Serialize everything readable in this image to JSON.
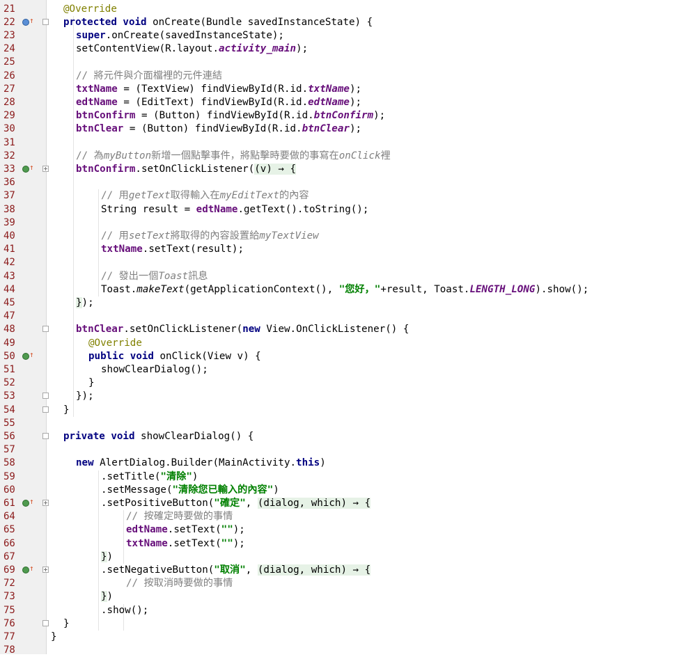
{
  "editor": {
    "lines": [
      {
        "n": "21",
        "seg": [
          [
            "i",
            2
          ],
          [
            "an",
            "@Override"
          ]
        ]
      },
      {
        "n": "22",
        "g": "ov",
        "f": "m",
        "seg": [
          [
            "i",
            2
          ],
          [
            "kw",
            "protected void "
          ],
          [
            "",
            "onCreate(Bundle savedInstanceState) {"
          ]
        ]
      },
      {
        "n": "23",
        "seg": [
          [
            "i",
            4
          ],
          [
            "kw",
            "super"
          ],
          [
            "",
            ".onCreate(savedInstanceState);"
          ]
        ]
      },
      {
        "n": "24",
        "seg": [
          [
            "i",
            4
          ],
          [
            "",
            "setContentView(R.layout."
          ],
          [
            "fi",
            "activity_main"
          ],
          [
            "",
            ");"
          ]
        ]
      },
      {
        "n": "25",
        "seg": []
      },
      {
        "n": "26",
        "seg": [
          [
            "i",
            4
          ],
          [
            "cm",
            "// 將元件與介面檔裡的元件連結"
          ]
        ]
      },
      {
        "n": "27",
        "seg": [
          [
            "i",
            4
          ],
          [
            "fd",
            "txtName"
          ],
          [
            "",
            " = (TextView) findViewById(R.id."
          ],
          [
            "fi",
            "txtName"
          ],
          [
            "",
            ");"
          ]
        ]
      },
      {
        "n": "28",
        "seg": [
          [
            "i",
            4
          ],
          [
            "fd",
            "edtName"
          ],
          [
            "",
            " = (EditText) findViewById(R.id."
          ],
          [
            "fi",
            "edtName"
          ],
          [
            "",
            ");"
          ]
        ]
      },
      {
        "n": "29",
        "seg": [
          [
            "i",
            4
          ],
          [
            "fd",
            "btnConfirm"
          ],
          [
            "",
            " = (Button) findViewById(R.id."
          ],
          [
            "fi",
            "btnConfirm"
          ],
          [
            "",
            ");"
          ]
        ]
      },
      {
        "n": "30",
        "seg": [
          [
            "i",
            4
          ],
          [
            "fd",
            "btnClear"
          ],
          [
            "",
            " = (Button) findViewById(R.id."
          ],
          [
            "fi",
            "btnClear"
          ],
          [
            "",
            ");"
          ]
        ]
      },
      {
        "n": "31",
        "seg": []
      },
      {
        "n": "32",
        "seg": [
          [
            "i",
            4
          ],
          [
            "cm",
            "// 為"
          ],
          [
            "cmi",
            "myButton"
          ],
          [
            "cm",
            "新增一個點擊事件，將點擊時要做的事寫在"
          ],
          [
            "cmi",
            "onClick"
          ],
          [
            "cm",
            "裡"
          ]
        ]
      },
      {
        "n": "33",
        "g": "im",
        "f": "p",
        "seg": [
          [
            "i",
            4
          ],
          [
            "fd",
            "btnConfirm"
          ],
          [
            "",
            ".setOnClickListener("
          ],
          [
            "lam",
            "(v) → {"
          ]
        ]
      },
      {
        "n": "36",
        "seg": []
      },
      {
        "n": "37",
        "seg": [
          [
            "i",
            8
          ],
          [
            "cm",
            "// 用"
          ],
          [
            "cmi",
            "getText"
          ],
          [
            "cm",
            "取得輸入在"
          ],
          [
            "cmi",
            "myEditText"
          ],
          [
            "cm",
            "的內容"
          ]
        ]
      },
      {
        "n": "38",
        "seg": [
          [
            "i",
            8
          ],
          [
            "",
            "String result = "
          ],
          [
            "fd",
            "edtName"
          ],
          [
            "",
            ".getText().toString();"
          ]
        ]
      },
      {
        "n": "39",
        "seg": []
      },
      {
        "n": "40",
        "seg": [
          [
            "i",
            8
          ],
          [
            "cm",
            "// 用"
          ],
          [
            "cmi",
            "setText"
          ],
          [
            "cm",
            "將取得的內容設置給"
          ],
          [
            "cmi",
            "myTextView"
          ]
        ]
      },
      {
        "n": "41",
        "seg": [
          [
            "i",
            8
          ],
          [
            "fd",
            "txtName"
          ],
          [
            "",
            ".setText(result);"
          ]
        ]
      },
      {
        "n": "42",
        "seg": []
      },
      {
        "n": "43",
        "seg": [
          [
            "i",
            8
          ],
          [
            "cm",
            "// 發出一個"
          ],
          [
            "cmi",
            "Toast"
          ],
          [
            "cm",
            "訊息"
          ]
        ]
      },
      {
        "n": "44",
        "seg": [
          [
            "i",
            8
          ],
          [
            "",
            "Toast."
          ],
          [
            "mi",
            "makeText"
          ],
          [
            "",
            "(getApplicationContext(), "
          ],
          [
            "st",
            "\"您好，\""
          ],
          [
            "",
            "+result, Toast."
          ],
          [
            "fi",
            "LENGTH_LONG"
          ],
          [
            "",
            ").show();"
          ]
        ]
      },
      {
        "n": "45",
        "seg": [
          [
            "i",
            4
          ],
          [
            "lam",
            "}"
          ],
          [
            "",
            ");"
          ]
        ]
      },
      {
        "n": "47",
        "seg": []
      },
      {
        "n": "48",
        "f": "m",
        "seg": [
          [
            "i",
            4
          ],
          [
            "fd",
            "btnClear"
          ],
          [
            "",
            ".setOnClickListener("
          ],
          [
            "kw",
            "new "
          ],
          [
            "",
            "View.OnClickListener() {"
          ]
        ]
      },
      {
        "n": "49",
        "seg": [
          [
            "i",
            6
          ],
          [
            "an",
            "@Override"
          ]
        ]
      },
      {
        "n": "50",
        "g": "im",
        "seg": [
          [
            "i",
            6
          ],
          [
            "kw",
            "public void "
          ],
          [
            "",
            "onClick(View v) {"
          ]
        ]
      },
      {
        "n": "51",
        "seg": [
          [
            "i",
            8
          ],
          [
            "",
            "showClearDialog();"
          ]
        ]
      },
      {
        "n": "52",
        "seg": [
          [
            "i",
            6
          ],
          [
            "",
            "}"
          ]
        ]
      },
      {
        "n": "53",
        "f": "e",
        "seg": [
          [
            "i",
            4
          ],
          [
            "",
            "});"
          ]
        ]
      },
      {
        "n": "54",
        "f": "e",
        "seg": [
          [
            "i",
            2
          ],
          [
            "",
            "}"
          ]
        ]
      },
      {
        "n": "55",
        "seg": []
      },
      {
        "n": "56",
        "f": "m",
        "seg": [
          [
            "i",
            2
          ],
          [
            "kw",
            "private void "
          ],
          [
            "",
            "showClearDialog() {"
          ]
        ]
      },
      {
        "n": "57",
        "seg": []
      },
      {
        "n": "58",
        "seg": [
          [
            "i",
            4
          ],
          [
            "kw",
            "new "
          ],
          [
            "",
            "AlertDialog.Builder(MainActivity."
          ],
          [
            "kw",
            "this"
          ],
          [
            "",
            ")"
          ]
        ]
      },
      {
        "n": "59",
        "seg": [
          [
            "i",
            8
          ],
          [
            "",
            ".setTitle("
          ],
          [
            "st",
            "\"清除\""
          ],
          [
            "",
            ")"
          ]
        ]
      },
      {
        "n": "60",
        "seg": [
          [
            "i",
            8
          ],
          [
            "",
            ".setMessage("
          ],
          [
            "st",
            "\"清除您已輸入的內容\""
          ],
          [
            "",
            ")"
          ]
        ]
      },
      {
        "n": "61",
        "g": "im",
        "f": "p",
        "seg": [
          [
            "i",
            8
          ],
          [
            "",
            ".setPositiveButton("
          ],
          [
            "st",
            "\"確定\""
          ],
          [
            "",
            ", "
          ],
          [
            "lam",
            "(dialog, which) → {"
          ]
        ]
      },
      {
        "n": "64",
        "seg": [
          [
            "i",
            12
          ],
          [
            "cm",
            "// 按確定時要做的事情"
          ]
        ]
      },
      {
        "n": "65",
        "seg": [
          [
            "i",
            12
          ],
          [
            "fd",
            "edtName"
          ],
          [
            "",
            ".setText("
          ],
          [
            "st",
            "\"\""
          ],
          [
            "",
            ");"
          ]
        ]
      },
      {
        "n": "66",
        "seg": [
          [
            "i",
            12
          ],
          [
            "fd",
            "txtName"
          ],
          [
            "",
            ".setText("
          ],
          [
            "st",
            "\"\""
          ],
          [
            "",
            ");"
          ]
        ]
      },
      {
        "n": "67",
        "seg": [
          [
            "i",
            8
          ],
          [
            "lam",
            "}"
          ],
          [
            "",
            ")"
          ]
        ]
      },
      {
        "n": "69",
        "g": "im",
        "f": "p",
        "seg": [
          [
            "i",
            8
          ],
          [
            "",
            ".setNegativeButton("
          ],
          [
            "st",
            "\"取消\""
          ],
          [
            "",
            ", "
          ],
          [
            "lam",
            "(dialog, which) → {"
          ]
        ]
      },
      {
        "n": "72",
        "seg": [
          [
            "i",
            12
          ],
          [
            "cm",
            "// 按取消時要做的事情"
          ]
        ]
      },
      {
        "n": "73",
        "seg": [
          [
            "i",
            8
          ],
          [
            "lam",
            "}"
          ],
          [
            "",
            ")"
          ]
        ]
      },
      {
        "n": "75",
        "seg": [
          [
            "i",
            8
          ],
          [
            "",
            ".show();"
          ]
        ]
      },
      {
        "n": "76",
        "f": "e",
        "seg": [
          [
            "i",
            2
          ],
          [
            "",
            "}"
          ]
        ]
      },
      {
        "n": "77",
        "seg": [
          [
            "",
            "}"
          ]
        ]
      },
      {
        "n": "78",
        "seg": []
      }
    ]
  },
  "gutter_icons": {
    "ov": "override-icon",
    "im": "implement-icon"
  },
  "colors": {
    "keyword": "#000080",
    "annotation": "#808000",
    "field": "#660e7a",
    "string": "#008000",
    "comment": "#808080",
    "line_number": "#8b1a1a"
  }
}
